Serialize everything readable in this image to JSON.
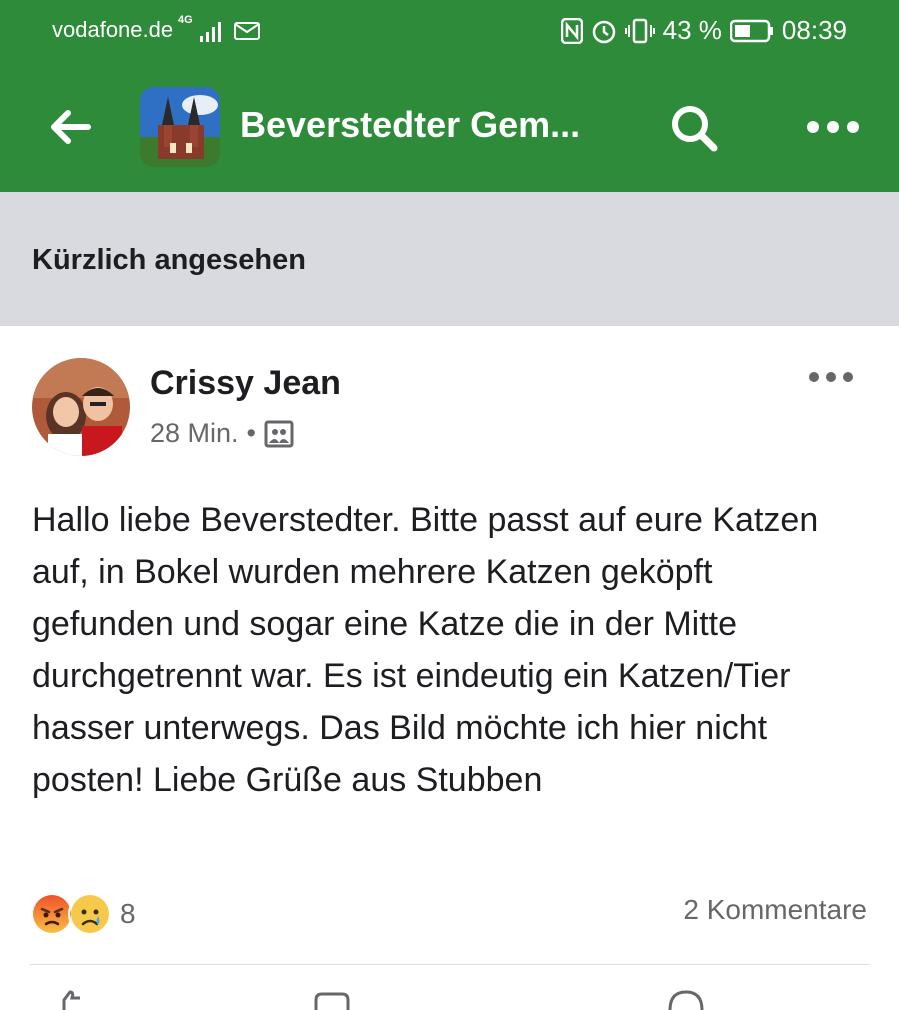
{
  "status_bar": {
    "carrier": "vodafone.de",
    "network": "4G",
    "battery": "43 %",
    "time": "08:39"
  },
  "app_bar": {
    "title": "Beverstedter Gem..."
  },
  "section": {
    "label": "Kürzlich angesehen"
  },
  "post": {
    "author": "Crissy Jean",
    "time": "28 Min.",
    "separator": "•",
    "text": "Hallo liebe Beverstedter. Bitte passt auf eure Katzen auf, in Bokel wurden mehrere Katzen geköpft gefunden und sogar eine Katze die in der Mitte durchgetrennt war. Es ist eindeutig ein Katzen/Tier hasser unterwegs. Das Bild möchte ich hier nicht posten! Liebe Grüße aus Stubben",
    "reaction_count": "8",
    "comments": "2 Kommentare",
    "reactions": [
      "angry-icon",
      "sad-icon"
    ]
  },
  "colors": {
    "brand_green": "#2e8b3a",
    "section_gray": "#d8dadf",
    "meta_gray": "#65676b"
  }
}
